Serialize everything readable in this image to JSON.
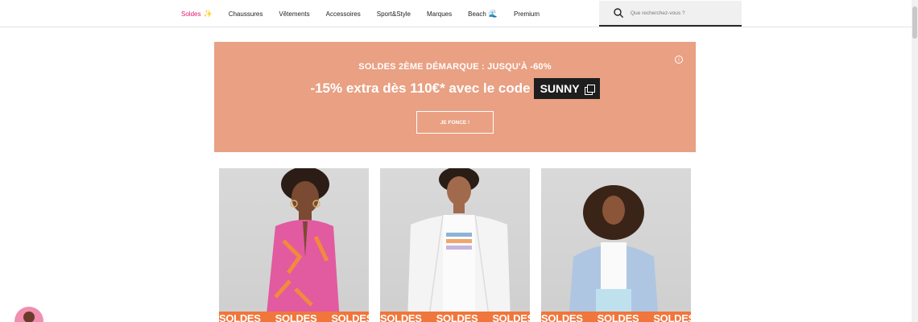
{
  "nav": {
    "items": [
      {
        "label": "Soldes",
        "icon": "sparkles-icon"
      },
      {
        "label": "Chaussures"
      },
      {
        "label": "Vêtements"
      },
      {
        "label": "Accessoires"
      },
      {
        "label": "Sport&Style"
      },
      {
        "label": "Marques"
      },
      {
        "label": "Beach",
        "icon": "wave-icon"
      },
      {
        "label": "Premium"
      }
    ]
  },
  "search": {
    "placeholder": "Que recherchez-vous ?"
  },
  "banner": {
    "kicker": "SOLDES 2ÈME DÉMARQUE : JUSQU'À -60%",
    "headline": "-15% extra dès 110€* avec le code",
    "code": "SUNNY",
    "cta": "JE FONCE !",
    "info": "i",
    "background": "#e9a083"
  },
  "cards": [
    {
      "ribbon": "SOLDES"
    },
    {
      "ribbon": "SOLDES"
    },
    {
      "ribbon": "SOLDES"
    }
  ],
  "colors": {
    "accent": "#e6196f",
    "ribbon": "#f0763b",
    "dark": "#1e1e1e"
  }
}
